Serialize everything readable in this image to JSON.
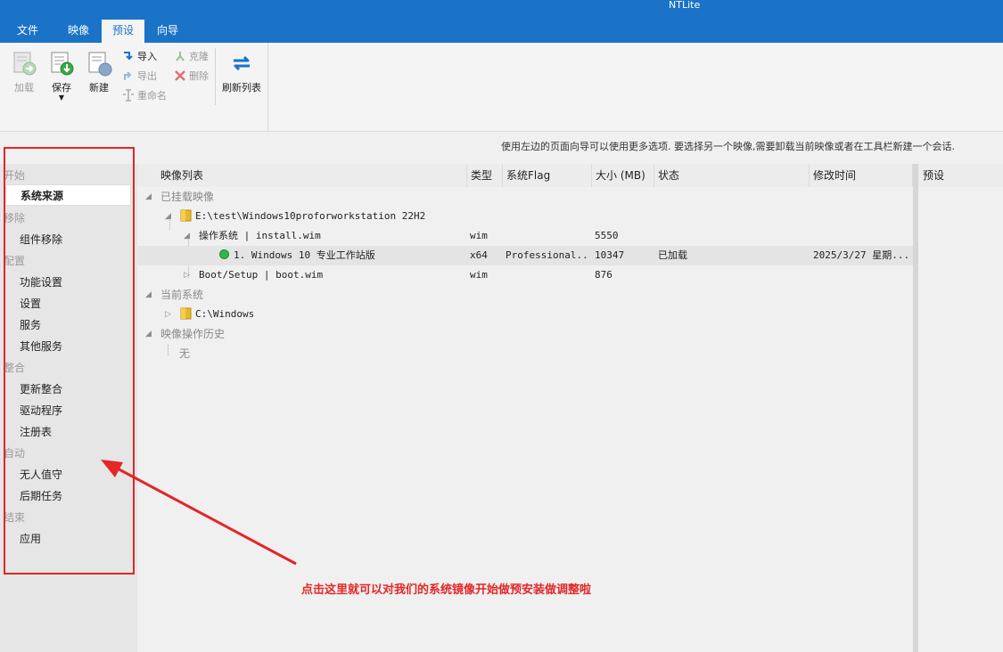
{
  "window": {
    "title": "NTLite"
  },
  "tabs": [
    {
      "label": "文件"
    },
    {
      "label": "映像"
    },
    {
      "label": "预设"
    },
    {
      "label": "向导"
    }
  ],
  "ribbon": {
    "load": "加载",
    "save": "保存",
    "new": "新建",
    "import": "导入",
    "export": "导出",
    "rename": "重命名",
    "clone": "克隆",
    "delete": "删除",
    "refresh": "刷新列表"
  },
  "info_hint": "使用左边的页面向导可以使用更多选项. 要选择另一个映像,需要卸载当前映像或者在工具栏新建一个会话.",
  "sidebar": {
    "sections": [
      {
        "label": "开始",
        "items": [
          "系统来源"
        ]
      },
      {
        "label": "移除",
        "items": [
          "组件移除"
        ]
      },
      {
        "label": "配置",
        "items": [
          "功能设置",
          "设置",
          "服务",
          "其他服务"
        ]
      },
      {
        "label": "整合",
        "items": [
          "更新整合",
          "驱动程序",
          "注册表"
        ]
      },
      {
        "label": "自动",
        "items": [
          "无人值守",
          "后期任务"
        ]
      },
      {
        "label": "结束",
        "items": [
          "应用"
        ]
      }
    ]
  },
  "table": {
    "columns": [
      "映像列表",
      "类型",
      "系统Flag",
      "大小 (MB)",
      "状态",
      "修改时间"
    ],
    "groups": {
      "mounted": "已挂载映像",
      "current": "当前系统",
      "history": "映像操作历史"
    },
    "mounted_path": "E:\\test\\Windows10proforworkstation 22H2",
    "os_node": {
      "name": "操作系统  |  install.wim",
      "type": "wim",
      "size": "5550"
    },
    "edition": {
      "name": "1. Windows 10 专业工作站版",
      "type": "x64",
      "flag": "Professional...",
      "size": "10347",
      "status": "已加载",
      "modified": "2025/3/27 星期..."
    },
    "boot_node": {
      "name": "Boot/Setup  |  boot.wim",
      "type": "wim",
      "size": "876"
    },
    "current_path": "C:\\Windows",
    "history_empty": "无"
  },
  "preset_panel": {
    "title": "预设"
  },
  "annotation": {
    "text": "点击这里就可以对我们的系统镜像开始做预安装做调整啦"
  },
  "colors": {
    "accent": "#1a73c7",
    "annotation": "#e32626",
    "status_ok": "#2fb74a"
  }
}
